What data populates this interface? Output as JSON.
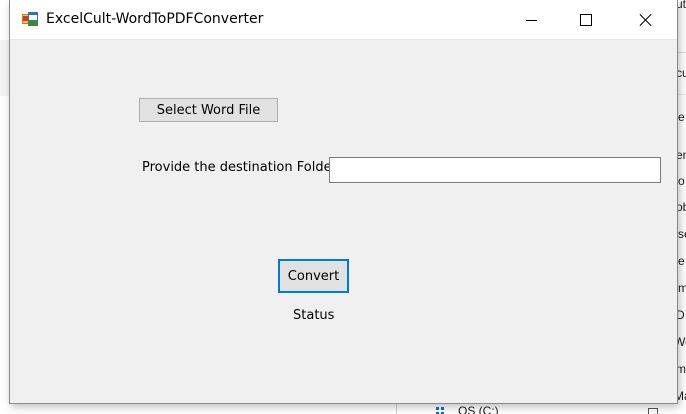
{
  "window": {
    "title": "ExcelCult-WordToPDFConverter",
    "controls": {
      "minimize": "minimize",
      "maximize": "maximize",
      "close": "close"
    }
  },
  "form": {
    "select_button_label": "Select Word File",
    "destination_label": "Provide the destination Folder",
    "destination_value": "",
    "convert_button_label": "Convert",
    "status_text": "Status"
  },
  "background": {
    "right_labels": [
      "ut",
      "cu",
      "e",
      "en",
      "o",
      "ob",
      "se",
      "e",
      "m",
      "D",
      "Wo",
      "mp",
      "Ma"
    ],
    "drive_label": "OS (C:)"
  },
  "colors": {
    "focus_accent": "#0078d7",
    "window_bg": "#f0f0f0",
    "button_bg": "#e1e1e1"
  }
}
